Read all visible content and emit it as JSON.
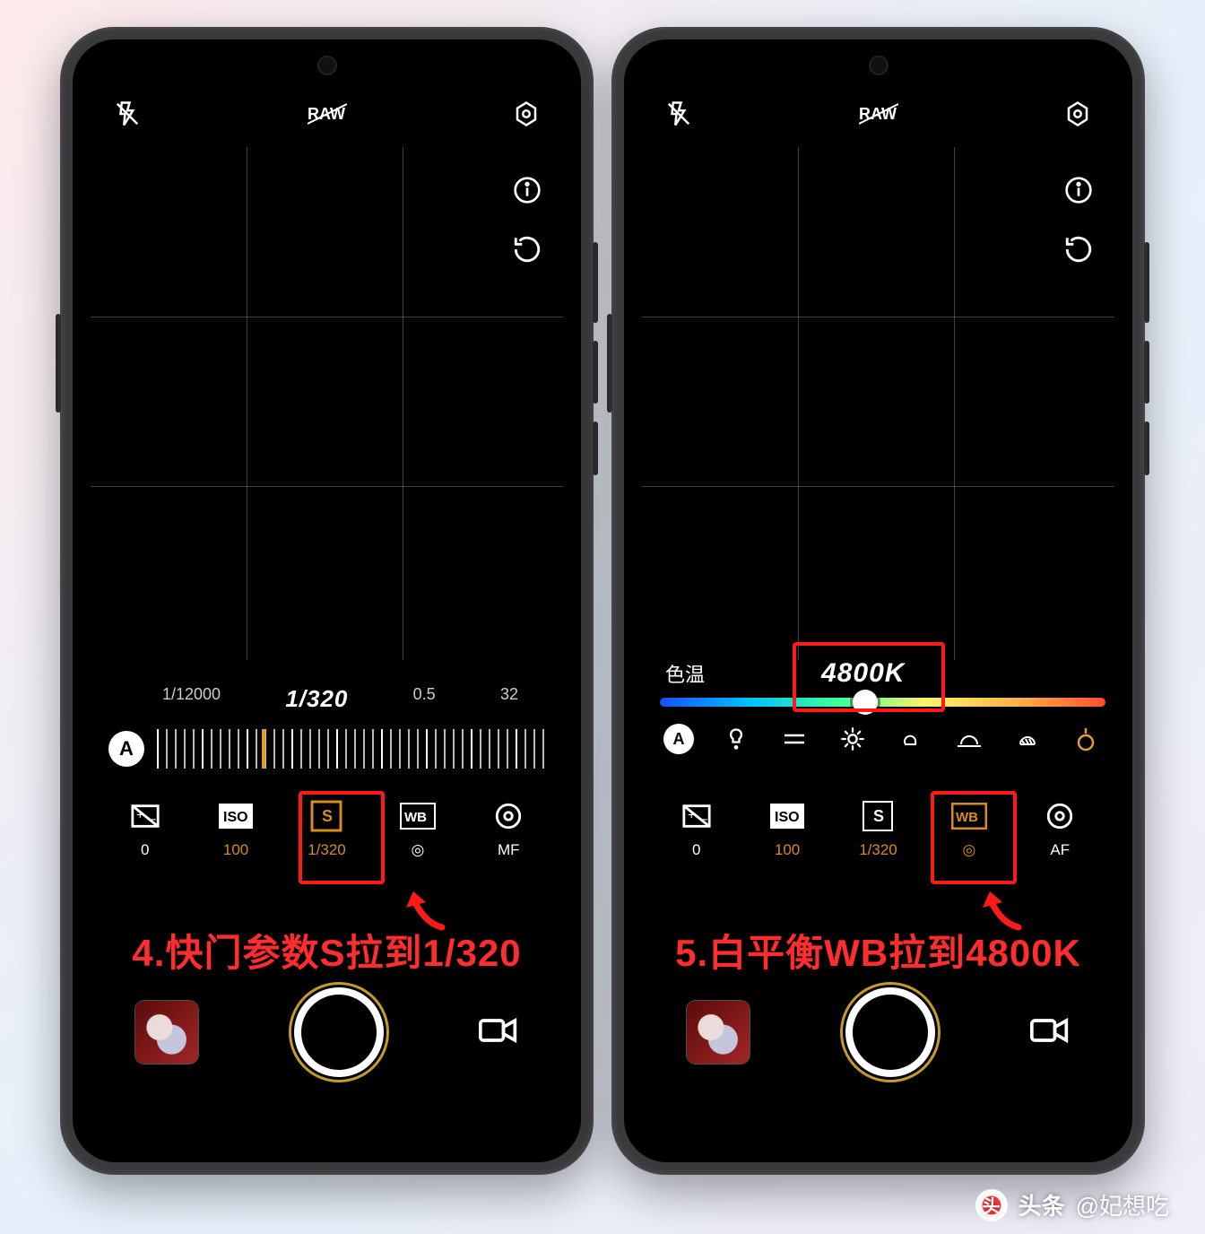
{
  "watermark": {
    "brand": "头条",
    "handle": "@妃想吃"
  },
  "phone1": {
    "annotation": "4.快门参数S拉到1/320",
    "slider": {
      "min": "1/12000",
      "value": "1/320",
      "mid": "0.5",
      "max": "32"
    },
    "params": {
      "ev": {
        "label": "0"
      },
      "iso": {
        "icon": "ISO",
        "label": "100"
      },
      "s": {
        "icon": "S",
        "label": "1/320"
      },
      "wb": {
        "icon": "WB",
        "label": "◎"
      },
      "focus": {
        "label": "MF"
      }
    }
  },
  "phone2": {
    "annotation": "5.白平衡WB拉到4800K",
    "wb": {
      "title": "色温",
      "value": "4800K"
    },
    "params": {
      "ev": {
        "label": "0"
      },
      "iso": {
        "icon": "ISO",
        "label": "100"
      },
      "s": {
        "icon": "S",
        "label": "1/320"
      },
      "wb": {
        "icon": "WB",
        "label": "◎"
      },
      "focus": {
        "label": "AF"
      }
    }
  }
}
